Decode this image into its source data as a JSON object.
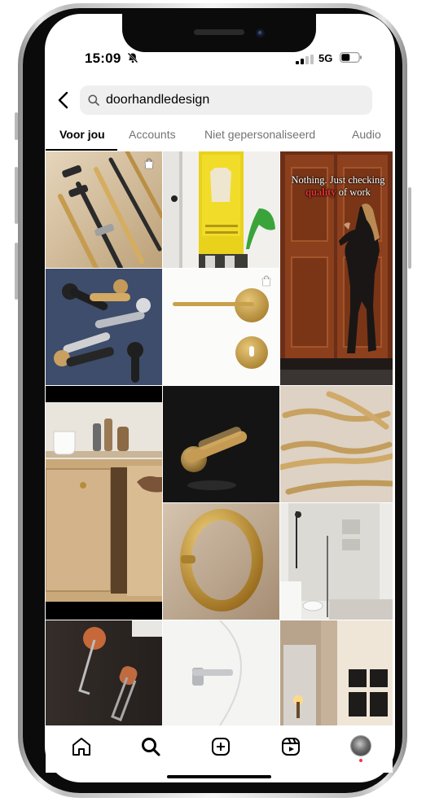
{
  "status_bar": {
    "time": "15:09",
    "network": "5G",
    "icons": [
      "bell-muted-icon",
      "signal-icon",
      "battery-icon"
    ]
  },
  "search": {
    "query": "doorhandledesign",
    "icon": "search-icon",
    "back_icon": "chevron-left-icon"
  },
  "tabs": [
    {
      "label": "Voor jou",
      "active": true
    },
    {
      "label": "Accounts",
      "active": false
    },
    {
      "label": "Niet gepersonaliseerd",
      "active": false
    },
    {
      "label": "Audio",
      "active": false
    }
  ],
  "grid": {
    "tiles": [
      {
        "name": "brass-bar-handles",
        "shop_badge": true
      },
      {
        "name": "yellow-closet-door",
        "shop_badge": false
      },
      {
        "name": "wooden-door-woman-reel",
        "shop_badge": false
      },
      {
        "name": "lever-handles-blue",
        "shop_badge": false
      },
      {
        "name": "brass-lever-on-white",
        "shop_badge": true
      },
      {
        "name": "wood-cabinet-knob",
        "shop_badge": false
      },
      {
        "name": "knurled-lever-black",
        "shop_badge": false
      },
      {
        "name": "brass-pull-handles",
        "shop_badge": false
      },
      {
        "name": "brass-ring-handle",
        "shop_badge": false
      },
      {
        "name": "shower-bathroom",
        "shop_badge": false
      },
      {
        "name": "wood-leather-pull",
        "shop_badge": false
      },
      {
        "name": "white-door-lever",
        "shop_badge": false
      },
      {
        "name": "sconce-wall",
        "shop_badge": false
      }
    ],
    "overlay_text": {
      "before": "Nothing. Just checking ",
      "highlight": "quality",
      "after": " of work"
    }
  },
  "bottom_nav": [
    {
      "name": "home-icon"
    },
    {
      "name": "search-icon"
    },
    {
      "name": "create-icon"
    },
    {
      "name": "reels-icon"
    },
    {
      "name": "profile-avatar"
    }
  ],
  "colors": {
    "accent_dot": "#ff3040",
    "brass": "#c9a45c",
    "tab_inactive": "#737373"
  }
}
